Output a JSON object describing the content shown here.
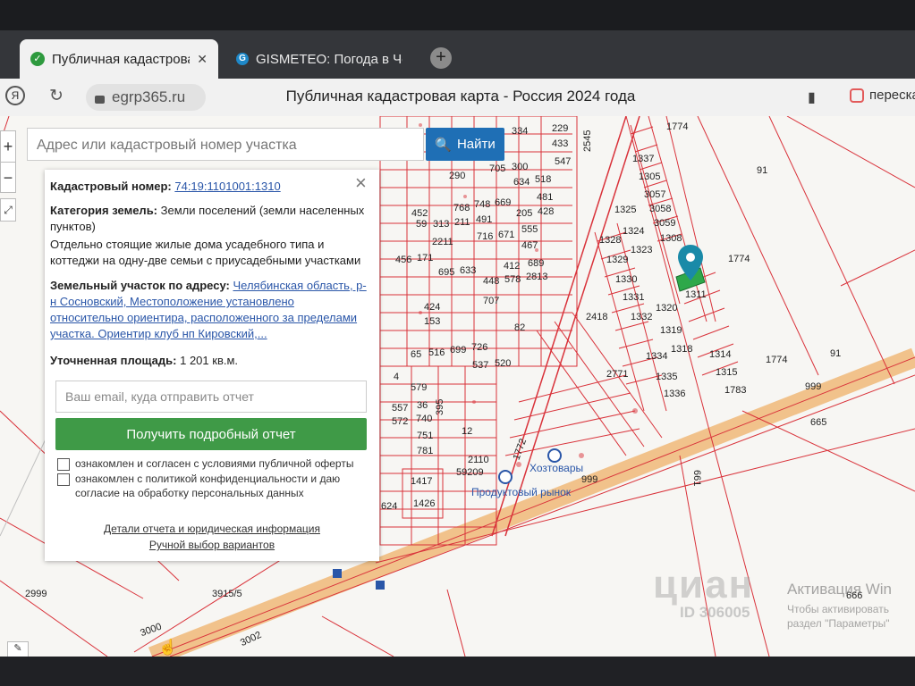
{
  "browser": {
    "tabs": [
      {
        "title": "Публичная кадастрова",
        "favicon": "check-circle-icon"
      },
      {
        "title": "GISMETEO: Погода в Чел",
        "favicon": "g-logo-icon"
      }
    ],
    "domain": "egrp365.ru",
    "page_title": "Публичная кадастровая карта - Россия 2024 года",
    "share_label": "переска"
  },
  "search": {
    "placeholder": "Адрес или кадастровый номер участка",
    "button_label": "Найти"
  },
  "info_panel": {
    "cadastral_label": "Кадастровый номер:",
    "cadastral_number": "74:19:1101001:1310",
    "category_label": "Категория земель:",
    "category_value": "Земли поселений (земли населенных пунктов)",
    "usage": "Отдельно стоящие жилые дома усадебного типа и коттеджи на одну-две семьи с приусадебными участками",
    "address_label": "Земельный участок по адресу:",
    "address_value": "Челябинская область, р-н Сосновский, Местоположение установлено относительно ориентира, расположенного за пределами участка. Ориентир клуб нп Кировский,...",
    "area_label": "Уточненная площадь:",
    "area_value": "1 201 кв.м.",
    "email_placeholder": "Ваш email, куда отправить отчет",
    "report_button": "Получить подробный отчет",
    "consent_1": "ознакомлен и согласен с условиями публичной оферты",
    "consent_2": "ознакомлен с политикой конфиденциальности и даю согласие на обработку персональных данных",
    "details_link": "Детали отчета и юридическая информация",
    "manual_link": "Ручной выбор вариантов"
  },
  "map_labels": {
    "parcels_top": [
      "229",
      "433",
      "547",
      "300",
      "518",
      "481",
      "705",
      "634",
      "290",
      "2545",
      "334"
    ],
    "parcels_mid": [
      "452",
      "768",
      "748",
      "669",
      "205",
      "428",
      "59",
      "313",
      "211",
      "491",
      "2211",
      "716",
      "671",
      "555",
      "467",
      "456",
      "171",
      "695",
      "633",
      "412",
      "689",
      "448",
      "578",
      "2813"
    ],
    "parcels_lower": [
      "707",
      "424",
      "153",
      "82",
      "65",
      "516",
      "699",
      "726",
      "537",
      "520",
      "4",
      "579",
      "557",
      "36",
      "395",
      "572",
      "740",
      "751",
      "12",
      "781",
      "2110",
      "59209",
      "1417",
      "1426",
      "624"
    ],
    "parcels_right": [
      "1337",
      "1305",
      "3057",
      "3058",
      "3059",
      "1308",
      "1325",
      "1328",
      "1324",
      "1329",
      "1323",
      "1330",
      "1331",
      "1332",
      "1320",
      "1311",
      "1319",
      "1318",
      "1314",
      "1334",
      "1315",
      "1335",
      "1783",
      "1336",
      "2418",
      "2771"
    ],
    "big": [
      "1774",
      "91",
      "1774",
      "1774",
      "91",
      "999",
      "665",
      "661",
      "999",
      "1772",
      "2999",
      "3915/5",
      "3000",
      "3002",
      "666"
    ],
    "places": [
      "Хозтовары",
      "Продуктовый рынок"
    ]
  },
  "watermark": {
    "cian": "циан",
    "cian_id": "ID 306005",
    "activation_title": "Активация Win",
    "activation_text": "Чтобы активировать раздел \"Параметры\""
  },
  "colors": {
    "parcel_line": "#d9323a",
    "road": "#f0b878",
    "accent": "#1f6fb5",
    "green_button": "#3f9a47",
    "selected_parcel": "#2ea84a"
  }
}
